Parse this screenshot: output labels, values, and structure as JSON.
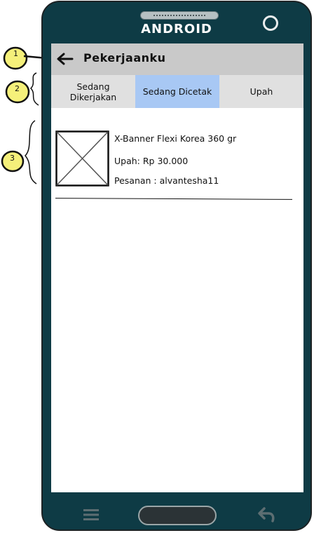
{
  "device": {
    "brand_label": "ANDROID"
  },
  "appbar": {
    "title": "Pekerjaanku",
    "back_icon": "back-arrow-icon"
  },
  "tabs": [
    {
      "label": "Sedang Dikerjakan",
      "active": false
    },
    {
      "label": "Sedang Dicetak",
      "active": true
    },
    {
      "label": "Upah",
      "active": false
    }
  ],
  "items": [
    {
      "name": "X-Banner Flexi Korea 360 gr",
      "wage": "Upah: Rp 30.000",
      "order": "Pesanan : alvantesha11",
      "image_icon": "image-placeholder-icon"
    }
  ],
  "navbar": {
    "menu_icon": "menu-icon",
    "home_icon": "home-button",
    "back_icon": "undo-arrow-icon"
  },
  "annotations": [
    {
      "number": "1"
    },
    {
      "number": "2"
    },
    {
      "number": "3"
    }
  ],
  "colors": {
    "phone_body": "#0e3b45",
    "appbar": "#c9c9c9",
    "tabbar": "#e0e0e0",
    "active_tab": "#a8c8f4",
    "annotation_fill": "#f5f07a"
  }
}
